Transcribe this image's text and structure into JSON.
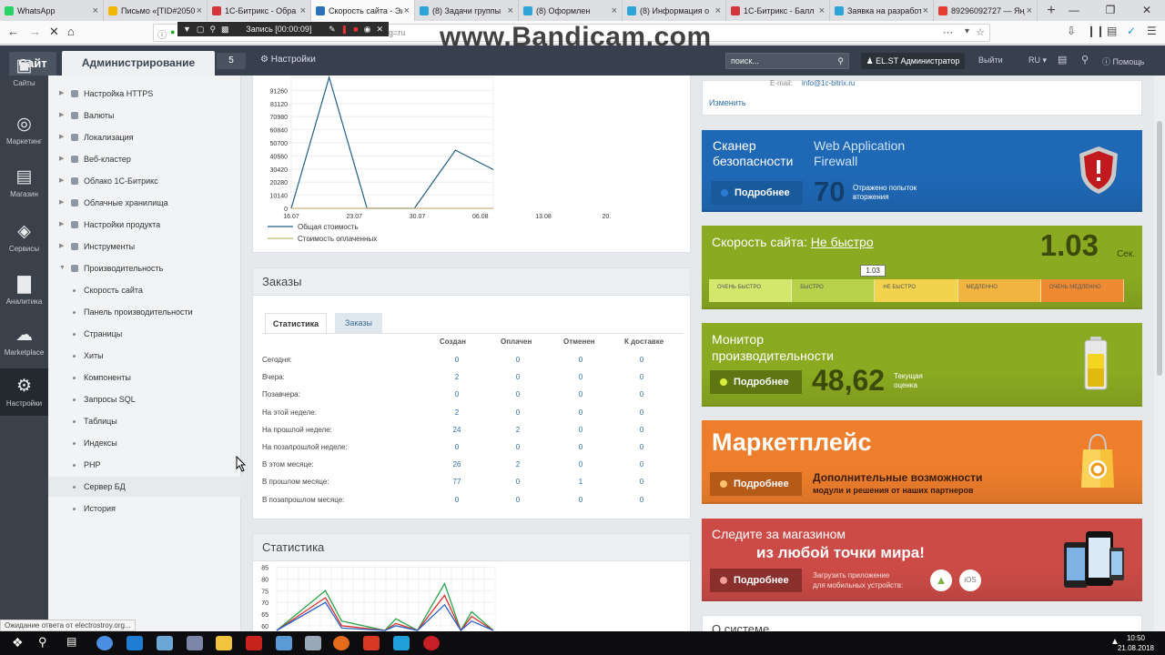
{
  "browser": {
    "tabs": [
      {
        "label": "WhatsApp",
        "color": "#25d366"
      },
      {
        "label": "Письмо «[TID#2050",
        "color": "#f2b705"
      },
      {
        "label": "1С-Битрикс - Обра",
        "color": "#d6363b"
      },
      {
        "label": "Скорость сайта - Эл",
        "color": "#2a72b8"
      },
      {
        "label": "(8) Задачи группы",
        "color": "#2fa4d8"
      },
      {
        "label": "(8) Оформлен",
        "color": "#2fa4d8"
      },
      {
        "label": "(8) Информация о",
        "color": "#2fa4d8"
      },
      {
        "label": "1С-Битрикс - Балл",
        "color": "#d6363b"
      },
      {
        "label": "Заявка на разработ",
        "color": "#2fa4d8"
      },
      {
        "label": "89296092727 — Янде",
        "color": "#e43c2f"
      }
    ],
    "active_tab": 3,
    "url_suffix": "g=ru",
    "watermark": "www.Bandicam.com",
    "recording_label": "Запись [00:00:09]",
    "status_text": "Ожидание ответа от electrostroy.org..."
  },
  "admin_header": {
    "site_tab": "Сайт",
    "admin_tab": "Администрирование",
    "notif_count": "5",
    "settings_label": "Настройки",
    "search_placeholder": "поиск...",
    "user_label": "EL.ST Администратор",
    "logout_label": "Выйти",
    "lang_label": "RU",
    "help_label": "Помощь"
  },
  "rail": [
    {
      "label": "Сайты",
      "icon": "sites-icon"
    },
    {
      "label": "Маркетинг",
      "icon": "target-icon"
    },
    {
      "label": "Магазин",
      "icon": "basket-icon"
    },
    {
      "label": "Сервисы",
      "icon": "layers-icon"
    },
    {
      "label": "Аналитика",
      "icon": "bars-icon"
    },
    {
      "label": "Marketplace",
      "icon": "cloud-icon"
    },
    {
      "label": "Настройки",
      "icon": "gear-icon"
    }
  ],
  "tree": [
    {
      "label": "Настройка HTTPS",
      "sub": false
    },
    {
      "label": "Валюты",
      "sub": false
    },
    {
      "label": "Локализация",
      "sub": false
    },
    {
      "label": "Веб-кластер",
      "sub": false
    },
    {
      "label": "Облако 1С-Битрикс",
      "sub": false
    },
    {
      "label": "Облачные хранилища",
      "sub": false
    },
    {
      "label": "Настройки продукта",
      "sub": false
    },
    {
      "label": "Инструменты",
      "sub": false
    },
    {
      "label": "Производительность",
      "sub": false
    },
    {
      "label": "Скорость сайта",
      "sub": true
    },
    {
      "label": "Панель производительности",
      "sub": true
    },
    {
      "label": "Страницы",
      "sub": true
    },
    {
      "label": "Хиты",
      "sub": true
    },
    {
      "label": "Компоненты",
      "sub": true
    },
    {
      "label": "Запросы SQL",
      "sub": true
    },
    {
      "label": "Таблицы",
      "sub": true
    },
    {
      "label": "Индексы",
      "sub": true
    },
    {
      "label": "PHP",
      "sub": true
    },
    {
      "label": "Сервер БД",
      "sub": true
    },
    {
      "label": "История",
      "sub": true
    }
  ],
  "chart_data": [
    {
      "type": "line",
      "title": "",
      "y_ticks": [
        "91260",
        "81120",
        "70980",
        "60840",
        "50700",
        "40560",
        "30420",
        "20280",
        "10140",
        "0"
      ],
      "ylim": [
        0,
        101400
      ],
      "x": [
        "16.07",
        "23.07",
        "30.07",
        "06.08",
        "13.08",
        "20."
      ],
      "series": [
        {
          "name": "Общая стоимость",
          "color": "#1f5f85",
          "points": [
            [
              0,
              0
            ],
            [
              0.6,
              101400
            ],
            [
              1.2,
              0
            ],
            [
              1.95,
              0
            ],
            [
              2.6,
              45000
            ],
            [
              3.2,
              30000
            ]
          ]
        },
        {
          "name": "Стоимость оплаченных",
          "color": "#c8b27a",
          "points": [
            [
              0,
              0
            ],
            [
              3.2,
              0
            ]
          ]
        }
      ]
    },
    {
      "type": "line",
      "title": "Статистика",
      "y_ticks": [
        "85",
        "80",
        "75",
        "70",
        "65",
        "60"
      ],
      "ylim": [
        58,
        86
      ],
      "series": [
        {
          "name": "",
          "color": "#2aa34a",
          "points": [
            [
              0,
              58
            ],
            [
              0.45,
              75
            ],
            [
              0.6,
              62
            ],
            [
              1.0,
              58
            ],
            [
              1.1,
              63
            ],
            [
              1.3,
              58
            ],
            [
              1.55,
              78
            ],
            [
              1.7,
              58
            ],
            [
              1.8,
              66
            ],
            [
              2.0,
              58
            ]
          ]
        },
        {
          "name": "",
          "color": "#d9312b",
          "points": [
            [
              0,
              58
            ],
            [
              0.45,
              72
            ],
            [
              0.6,
              60
            ],
            [
              1.0,
              58
            ],
            [
              1.1,
              61
            ],
            [
              1.3,
              58
            ],
            [
              1.55,
              73
            ],
            [
              1.7,
              58
            ],
            [
              1.8,
              64
            ],
            [
              2.0,
              58
            ]
          ]
        },
        {
          "name": "",
          "color": "#2a62c7",
          "points": [
            [
              0,
              58
            ],
            [
              0.45,
              70
            ],
            [
              0.6,
              59
            ],
            [
              1.0,
              58
            ],
            [
              1.1,
              60
            ],
            [
              1.3,
              58
            ],
            [
              1.55,
              69
            ],
            [
              1.7,
              58
            ],
            [
              1.8,
              62
            ],
            [
              2.0,
              58
            ]
          ]
        }
      ]
    }
  ],
  "orders": {
    "title": "Заказы",
    "tab_stats": "Статистика",
    "tab_orders": "Заказы",
    "columns": [
      "Создан",
      "Оплачен",
      "Отменен",
      "К доставке"
    ],
    "rows": [
      {
        "label": "Сегодня:",
        "values": [
          "0",
          "0",
          "0",
          "0"
        ]
      },
      {
        "label": "Вчера:",
        "values": [
          "2",
          "0",
          "0",
          "0"
        ]
      },
      {
        "label": "Позавчера:",
        "values": [
          "0",
          "0",
          "0",
          "0"
        ]
      },
      {
        "label": "На этой неделе:",
        "values": [
          "2",
          "0",
          "0",
          "0"
        ]
      },
      {
        "label": "На прошлой неделе:",
        "values": [
          "24",
          "2",
          "0",
          "0"
        ]
      },
      {
        "label": "На позапрошлой неделе:",
        "values": [
          "0",
          "0",
          "0",
          "0"
        ]
      },
      {
        "label": "В этом месяце:",
        "values": [
          "26",
          "2",
          "0",
          "0"
        ]
      },
      {
        "label": "В прошлом месяце:",
        "values": [
          "77",
          "0",
          "1",
          "0"
        ]
      },
      {
        "label": "В позапрошлом месяце:",
        "values": [
          "0",
          "0",
          "0",
          "0"
        ]
      }
    ]
  },
  "stats_title": "Статистика",
  "info": {
    "email_label": "E-mail:",
    "email": "info@1c-bitrix.ru",
    "edit_link": "Изменить"
  },
  "security": {
    "title": "Сканер безопасности",
    "waf": "Web Application Firewall",
    "more": "Подробнее",
    "count": "70",
    "count_label": "Отражено попыток вторжения",
    "color": "#1f68b5"
  },
  "speed": {
    "title": "Скорость сайта:",
    "status": "Не быстро",
    "value": "1.03",
    "unit": "Сек.",
    "marker": "1.03",
    "marker_pos": 0.395,
    "scale": [
      "ОЧЕНЬ БЫСТРО",
      "БЫСТРО",
      "НЕ БЫСТРО",
      "МЕДЛЕННО",
      "ОЧЕНЬ МЕДЛЕННО"
    ],
    "color": "#8aaa21"
  },
  "perf": {
    "title": "Монитор производительности",
    "more": "Подробнее",
    "value": "48,62",
    "value_label": "Текущая оценка",
    "color": "#8aaa21"
  },
  "market": {
    "title": "Маркетплейс",
    "more": "Подробнее",
    "desc1": "Дополнительные возможности",
    "desc2": "модули и решения от наших партнеров",
    "color": "#ee7e2c"
  },
  "mobile": {
    "line1": "Следите за магазином",
    "line2": "из любой точки мира!",
    "more": "Подробнее",
    "app1": "Загрузить приложение",
    "app2": "для мобильных устройств:",
    "ios": "iOS",
    "color": "#cc4b47"
  },
  "about_title": "О системе",
  "clock": {
    "time": "10:50",
    "date": "21.08.2018"
  }
}
